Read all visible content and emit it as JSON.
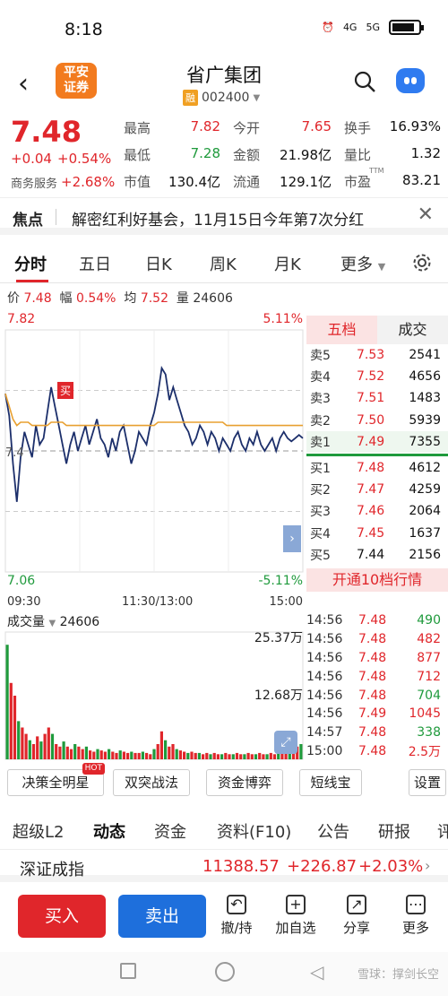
{
  "status_bar": {
    "time": "8:18",
    "net1": "4G",
    "net2": "5G"
  },
  "header": {
    "back": "‹",
    "logo_line1": "平安",
    "logo_line2": "证券",
    "title": "省广集团",
    "badge": "融",
    "code": "002400"
  },
  "quote": {
    "price": "7.48",
    "change": "+0.04",
    "change_pct": "+0.54%",
    "sector": "商务服务",
    "sector_pct": "+2.68%",
    "stats": [
      {
        "label": "最高",
        "value": "7.82",
        "color": "red"
      },
      {
        "label": "今开",
        "value": "7.65",
        "color": "red"
      },
      {
        "label": "换手",
        "value": "16.93%",
        "color": "black"
      },
      {
        "label": "最低",
        "value": "7.28",
        "color": "green"
      },
      {
        "label": "金额",
        "value": "21.98亿",
        "color": "black"
      },
      {
        "label": "量比",
        "value": "1.32",
        "color": "black"
      },
      {
        "label": "市值",
        "value": "130.4亿",
        "color": "black"
      },
      {
        "label": "流通",
        "value": "129.1亿",
        "color": "black"
      },
      {
        "label": "市盈",
        "value": "83.21",
        "color": "black"
      }
    ],
    "ttm": "TTM"
  },
  "focus": {
    "label": "焦点",
    "text": "解密红利好基会，11月15日今年第7次分红",
    "close": "✕"
  },
  "tabs": [
    "分时",
    "五日",
    "日K",
    "周K",
    "月K",
    "更多"
  ],
  "info": {
    "price_label": "价",
    "price": "7.48",
    "amp_label": "幅",
    "amp": "0.54%",
    "avg_label": "均",
    "avg": "7.52",
    "vol_label": "量",
    "vol": "24606"
  },
  "chart": {
    "high": "7.82",
    "low": "7.06",
    "high_pct": "5.11%",
    "low_pct": "-5.11%",
    "t_start": "09:30",
    "t_mid": "11:30/13:00",
    "t_end": "15:00",
    "mid_label": "7.4",
    "buy_marker": "买"
  },
  "chart_data": {
    "type": "line",
    "ylim": [
      7.06,
      7.82
    ],
    "prev_close": 7.44,
    "series": [
      {
        "values": [
          7.62,
          7.55,
          7.4,
          7.28,
          7.42,
          7.5,
          7.46,
          7.42,
          7.52,
          7.46,
          7.48,
          7.56,
          7.64,
          7.58,
          7.52,
          7.46,
          7.4,
          7.46,
          7.5,
          7.44,
          7.48,
          7.52,
          7.46,
          7.5,
          7.54,
          7.48,
          7.46,
          7.42,
          7.48,
          7.44,
          7.5,
          7.52,
          7.46,
          7.4,
          7.44,
          7.5,
          7.48,
          7.46,
          7.52,
          7.56,
          7.62,
          7.7,
          7.68,
          7.6,
          7.64,
          7.6,
          7.56,
          7.52,
          7.5,
          7.46,
          7.48,
          7.52,
          7.5,
          7.46,
          7.5,
          7.48,
          7.44,
          7.48,
          7.46,
          7.44,
          7.48,
          7.5,
          7.46,
          7.44,
          7.48,
          7.46,
          7.5,
          7.46,
          7.44,
          7.46,
          7.48,
          7.44,
          7.48,
          7.5,
          7.48,
          7.47,
          7.48,
          7.49,
          7.48
        ]
      },
      {
        "values": [
          7.62,
          7.58,
          7.54,
          7.52,
          7.53,
          7.53,
          7.53,
          7.52,
          7.52,
          7.52,
          7.52,
          7.52,
          7.53,
          7.53,
          7.53,
          7.53,
          7.52,
          7.52,
          7.52,
          7.52,
          7.52,
          7.52,
          7.52,
          7.52,
          7.52,
          7.52,
          7.52,
          7.52,
          7.52,
          7.52,
          7.52,
          7.52,
          7.52,
          7.52,
          7.52,
          7.52,
          7.52,
          7.52,
          7.52,
          7.52,
          7.53,
          7.53,
          7.53,
          7.53,
          7.53,
          7.53,
          7.53,
          7.53,
          7.53,
          7.53,
          7.53,
          7.53,
          7.53,
          7.53,
          7.53,
          7.53,
          7.53,
          7.53,
          7.52,
          7.52,
          7.52,
          7.52,
          7.52,
          7.52,
          7.52,
          7.52,
          7.52,
          7.52,
          7.52,
          7.52,
          7.52,
          7.52,
          7.52,
          7.52,
          7.52,
          7.52,
          7.52,
          7.52,
          7.52
        ]
      }
    ],
    "volume": {
      "max_label": "25.37万",
      "mid_label": "12.68万",
      "label": "成交量",
      "value": "24606",
      "values": [
        0.9,
        0.6,
        0.5,
        0.3,
        0.25,
        0.2,
        0.15,
        0.12,
        0.18,
        0.14,
        0.2,
        0.25,
        0.2,
        0.12,
        0.1,
        0.14,
        0.1,
        0.08,
        0.12,
        0.1,
        0.08,
        0.1,
        0.07,
        0.06,
        0.08,
        0.07,
        0.06,
        0.08,
        0.06,
        0.05,
        0.07,
        0.06,
        0.05,
        0.06,
        0.05,
        0.05,
        0.06,
        0.05,
        0.04,
        0.08,
        0.12,
        0.22,
        0.15,
        0.1,
        0.12,
        0.08,
        0.07,
        0.06,
        0.05,
        0.06,
        0.05,
        0.05,
        0.04,
        0.05,
        0.04,
        0.05,
        0.04,
        0.04,
        0.05,
        0.04,
        0.04,
        0.05,
        0.04,
        0.04,
        0.05,
        0.04,
        0.04,
        0.05,
        0.04,
        0.04,
        0.05,
        0.04,
        0.05,
        0.06,
        0.05,
        0.06,
        0.08,
        0.1,
        0.12
      ]
    }
  },
  "book": {
    "head1": "五档",
    "head2": "成交",
    "sell": [
      {
        "label": "卖5",
        "price": "7.53",
        "vol": "2541",
        "color": "red"
      },
      {
        "label": "卖4",
        "price": "7.52",
        "vol": "4656",
        "color": "red"
      },
      {
        "label": "卖3",
        "price": "7.51",
        "vol": "1483",
        "color": "red"
      },
      {
        "label": "卖2",
        "price": "7.50",
        "vol": "5939",
        "color": "red"
      },
      {
        "label": "卖1",
        "price": "7.49",
        "vol": "7355",
        "color": "red"
      }
    ],
    "buy": [
      {
        "label": "买1",
        "price": "7.48",
        "vol": "4612",
        "color": "red"
      },
      {
        "label": "买2",
        "price": "7.47",
        "vol": "4259",
        "color": "red"
      },
      {
        "label": "买3",
        "price": "7.46",
        "vol": "2064",
        "color": "red"
      },
      {
        "label": "买4",
        "price": "7.45",
        "vol": "1637",
        "color": "red"
      },
      {
        "label": "买5",
        "price": "7.44",
        "vol": "2156",
        "color": "black"
      }
    ],
    "open10": "开通10档行情"
  },
  "trades": [
    {
      "t": "14:56",
      "p": "7.48",
      "v": "490",
      "vc": "green"
    },
    {
      "t": "14:56",
      "p": "7.48",
      "v": "482",
      "vc": "red"
    },
    {
      "t": "14:56",
      "p": "7.48",
      "v": "877",
      "vc": "red"
    },
    {
      "t": "14:56",
      "p": "7.48",
      "v": "712",
      "vc": "red"
    },
    {
      "t": "14:56",
      "p": "7.48",
      "v": "704",
      "vc": "green"
    },
    {
      "t": "14:56",
      "p": "7.49",
      "v": "1045",
      "vc": "red"
    },
    {
      "t": "14:57",
      "p": "7.48",
      "v": "338",
      "vc": "green"
    },
    {
      "t": "15:00",
      "p": "7.48",
      "v": "2.5万",
      "vc": "red"
    }
  ],
  "tools": {
    "t1": "决策全明星",
    "hot": "HOT",
    "t2": "双突战法",
    "t3": "资金博弈",
    "t4": "短线宝",
    "t5": "设置"
  },
  "bottom_tabs": [
    "超级L2",
    "动态",
    "资金",
    "资料(F10)",
    "公告",
    "研报",
    "评"
  ],
  "index": {
    "name": "深证成指",
    "value": "11388.57",
    "change": "+226.87",
    "pct": "+2.03%"
  },
  "actions": {
    "buy": "买入",
    "sell": "卖出",
    "a1": "撤/持",
    "a2": "加自选",
    "a3": "分享",
    "a4": "更多"
  },
  "watermark": "雪球：撑剑长空"
}
